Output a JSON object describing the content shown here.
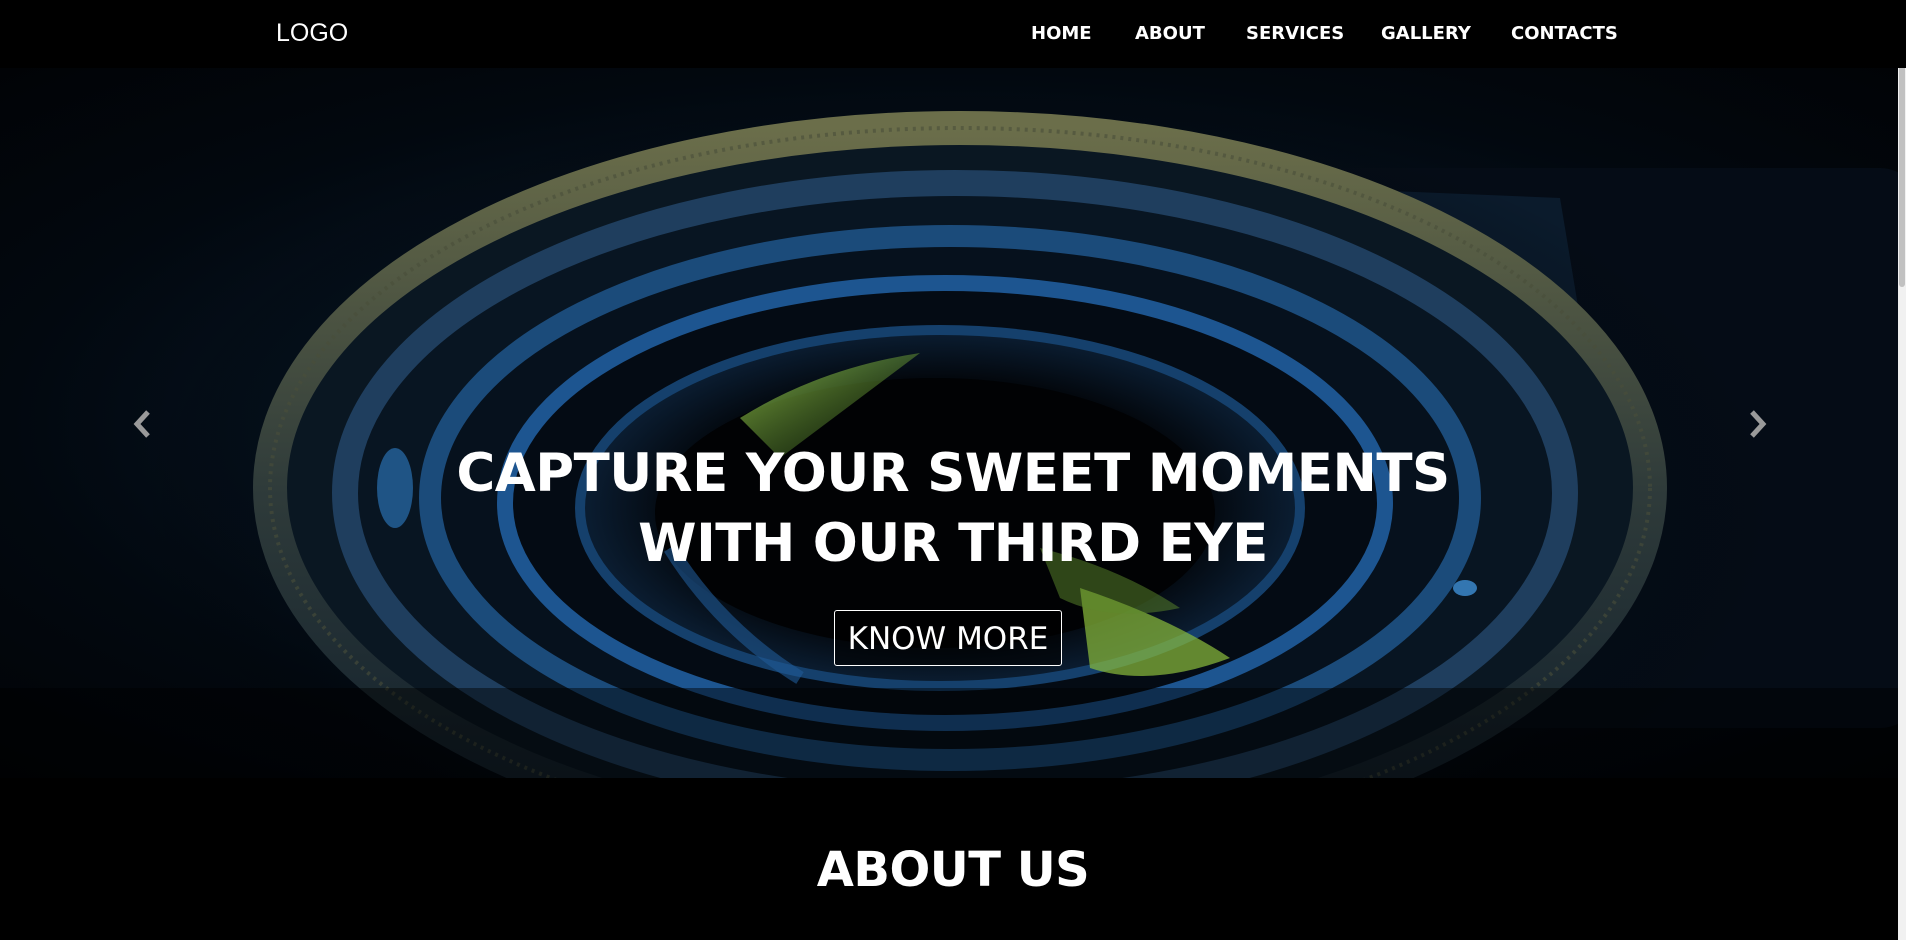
{
  "navbar": {
    "logo": "LOGO",
    "items": [
      "HOME",
      "ABOUT",
      "SERVICES",
      "GALLERY",
      "CONTACTS"
    ]
  },
  "hero": {
    "title_line1": "CAPTURE YOUR SWEET MOMENTS",
    "title_line2": "WITH OUR THIRD EYE",
    "cta_label": "KNOW MORE",
    "prev_icon": "chevron-left-icon",
    "next_icon": "chevron-right-icon"
  },
  "about": {
    "title": "ABOUT US"
  },
  "colors": {
    "background": "#000000",
    "text": "#ffffff",
    "hero_dark": "#02080f",
    "lens_blue": "#1c4f8a",
    "lens_green": "#7fb84a"
  }
}
